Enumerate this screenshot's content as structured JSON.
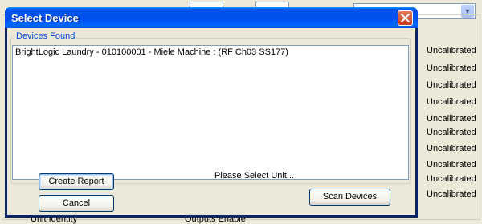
{
  "dialog": {
    "title": "Select Device",
    "group_label": "Devices Found",
    "devices": [
      "BrightLogic Laundry - 010100001 - Miele Machine : (RF Ch03 SS177)"
    ],
    "status_text": "Please Select Unit...",
    "buttons": {
      "create_report": "Create Report",
      "cancel": "Cancel",
      "scan_devices": "Scan Devices"
    }
  },
  "background": {
    "status_column": [
      "Uncalibrated",
      "Uncalibrated",
      "Uncalibrated",
      "Uncalibrated",
      "Uncalibrated",
      "Uncalibrated",
      "Uncalibrated",
      "Uncalibrated",
      "Uncalibrated",
      "Uncalibrated"
    ],
    "bottom_labels": [
      "Unit Identity",
      "Outputs Enable"
    ]
  },
  "colors": {
    "titlebar": "#0054e3",
    "group_label": "#0046d5",
    "close_button": "#c93d1a"
  }
}
